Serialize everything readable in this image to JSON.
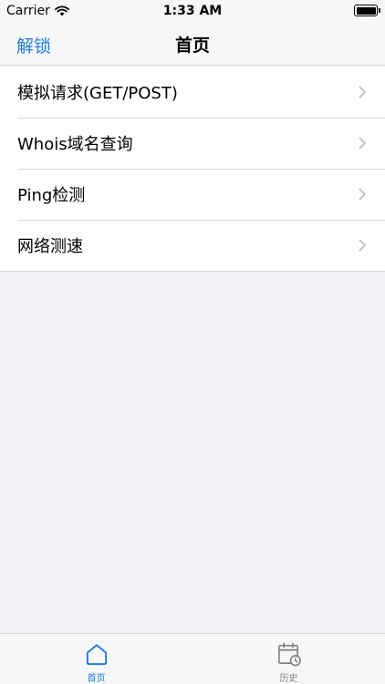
{
  "status_bar": {
    "carrier": "Carrier",
    "time": "1:33 AM"
  },
  "nav": {
    "left_button": "解锁",
    "title": "首页"
  },
  "menu": {
    "items": [
      {
        "label": "模拟请求(GET/POST)"
      },
      {
        "label": "Whois域名查询"
      },
      {
        "label": "Ping检测"
      },
      {
        "label": "网络测速"
      }
    ]
  },
  "tabs": [
    {
      "label": "首页",
      "icon": "home-icon",
      "active": true
    },
    {
      "label": "历史",
      "icon": "history-calendar-icon",
      "active": false
    }
  ],
  "colors": {
    "accent": "#1f7ce0",
    "background": "#f2f2f7",
    "inactive_tab": "#7c7c80"
  }
}
